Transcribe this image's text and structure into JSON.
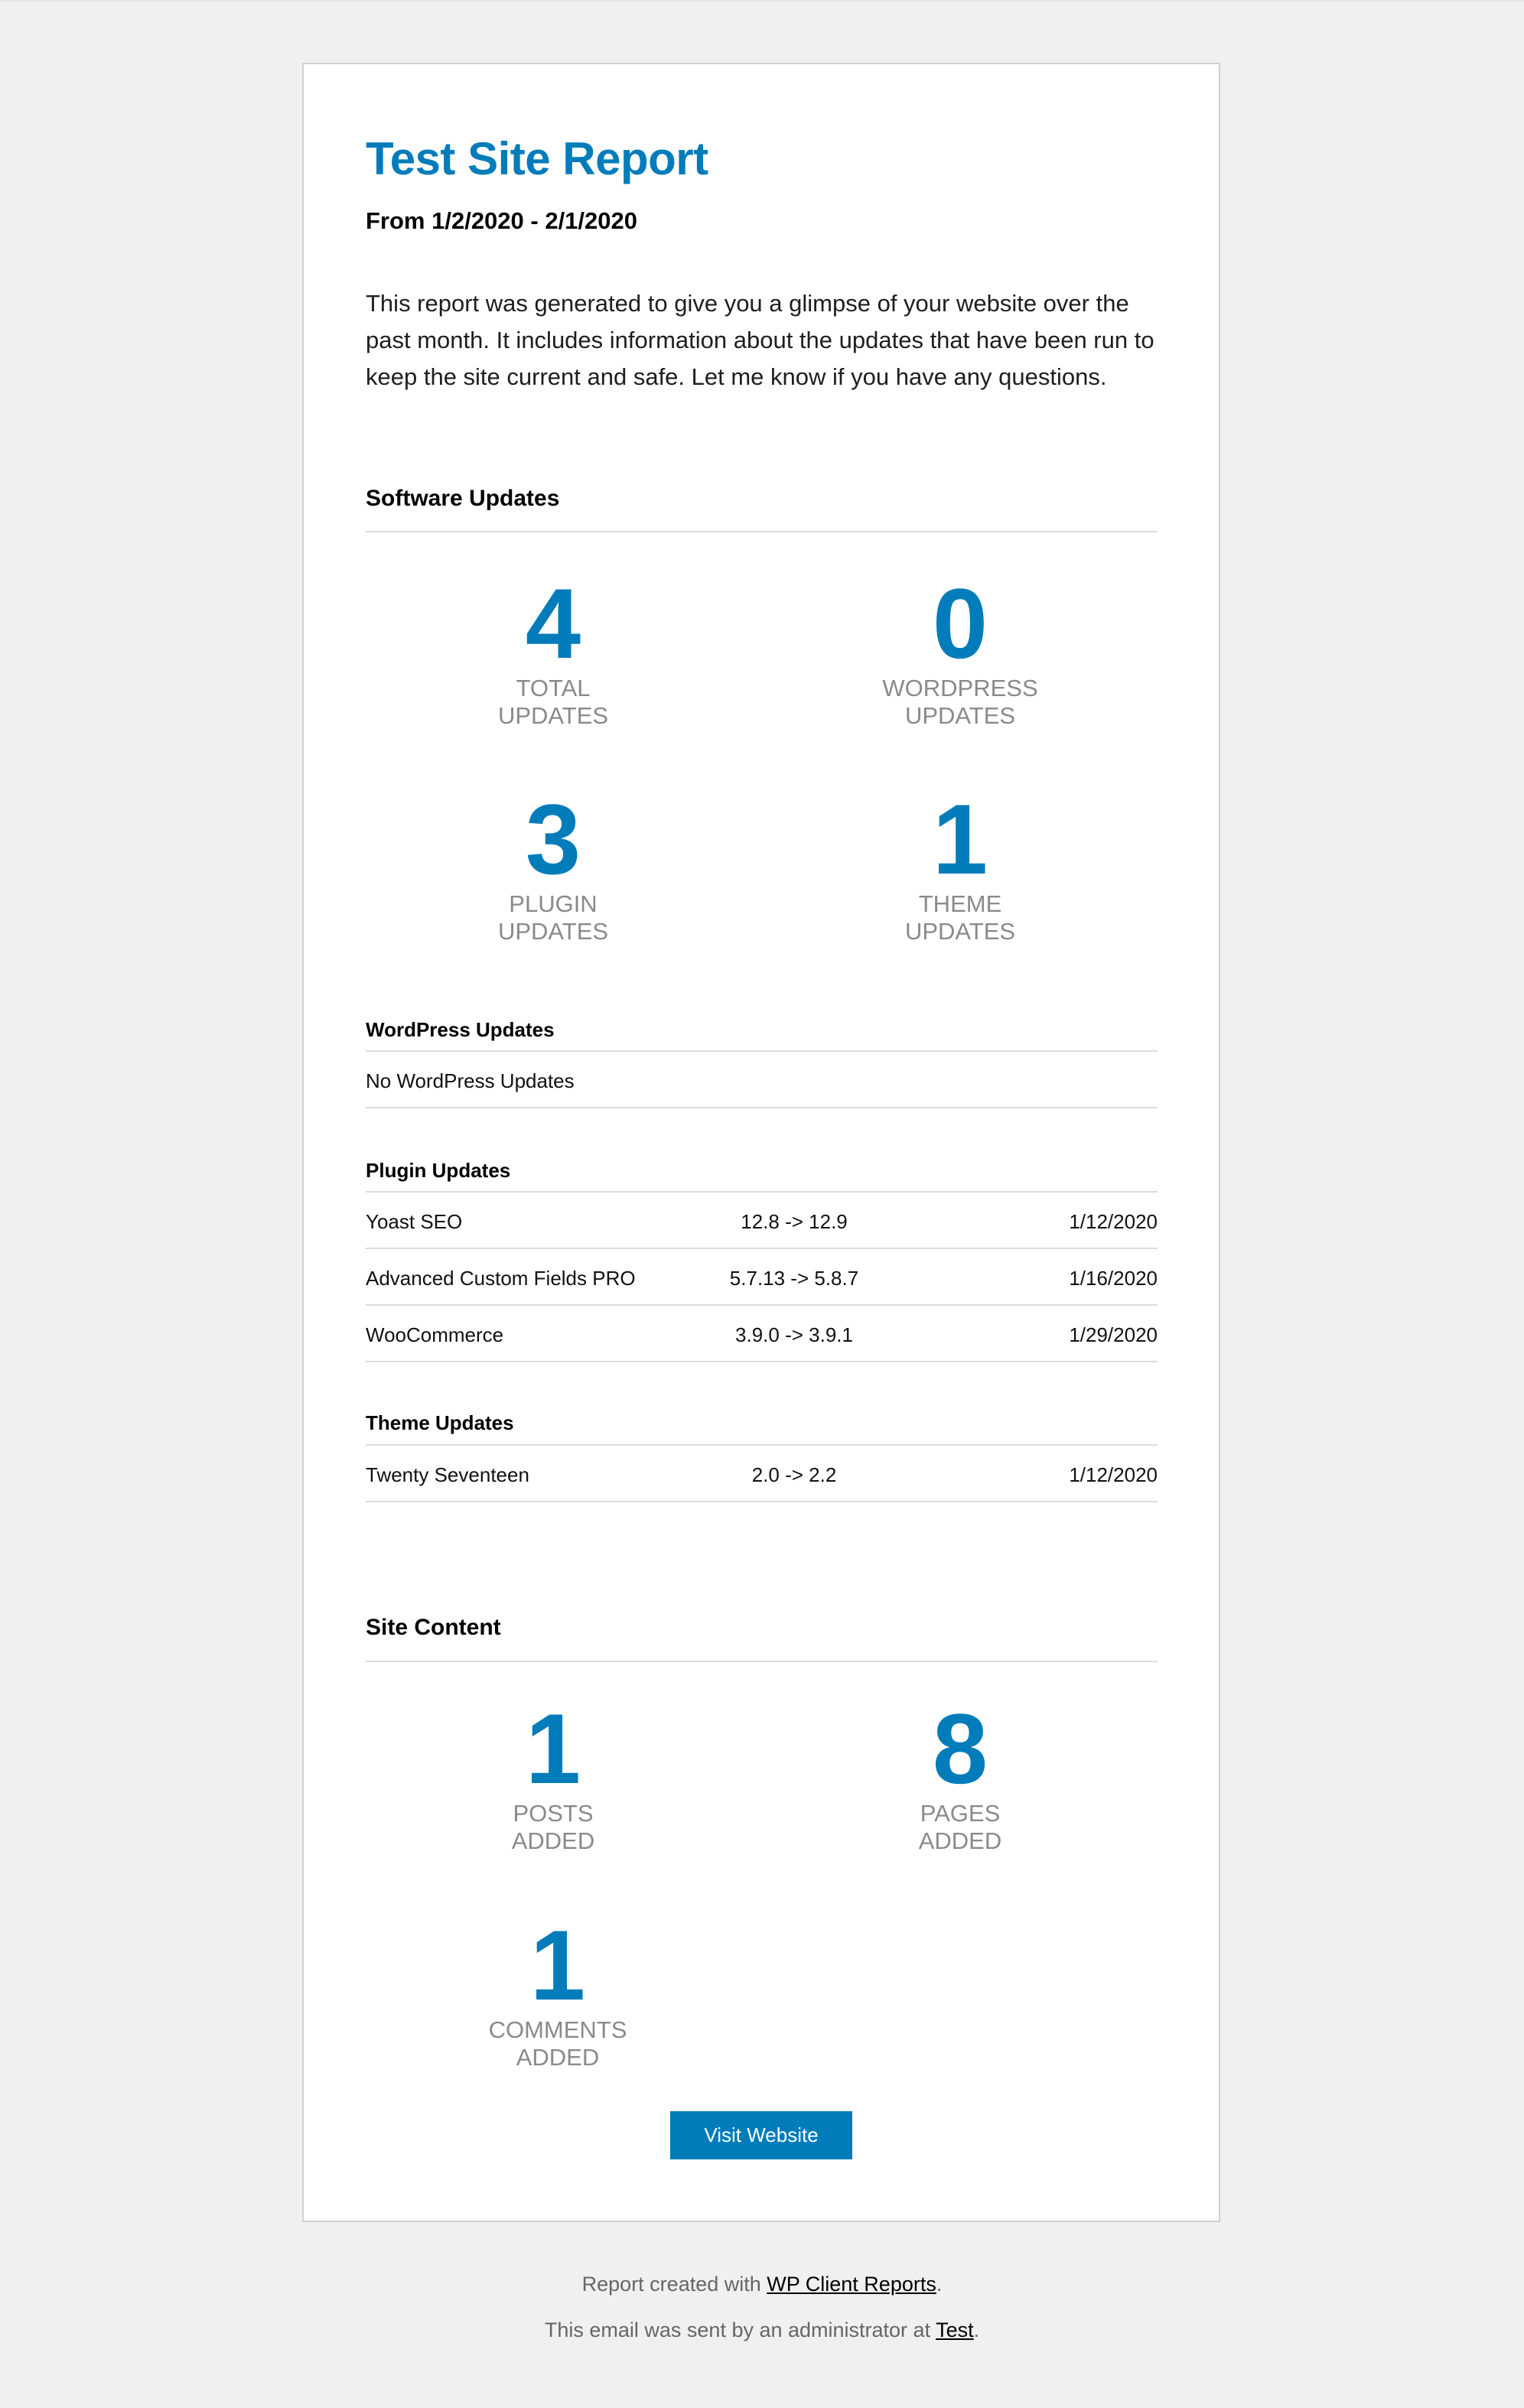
{
  "report": {
    "title": "Test Site Report",
    "date_range": "From 1/2/2020 - 2/1/2020",
    "intro": "This report was generated to give you a glimpse of your website over the past month. It includes information about the updates that have been run to keep the site current and safe. Let me know if you have any questions."
  },
  "software_updates": {
    "heading": "Software Updates",
    "stats": [
      {
        "value": "4",
        "label_line1": "TOTAL",
        "label_line2": "UPDATES"
      },
      {
        "value": "0",
        "label_line1": "WORDPRESS",
        "label_line2": "UPDATES"
      },
      {
        "value": "3",
        "label_line1": "PLUGIN",
        "label_line2": "UPDATES"
      },
      {
        "value": "1",
        "label_line1": "THEME",
        "label_line2": "UPDATES"
      }
    ],
    "wordpress": {
      "heading": "WordPress Updates",
      "empty_text": "No WordPress Updates"
    },
    "plugins": {
      "heading": "Plugin Updates",
      "rows": [
        {
          "name": "Yoast SEO",
          "version": "12.8 -> 12.9",
          "date": "1/12/2020"
        },
        {
          "name": "Advanced Custom Fields PRO",
          "version": "5.7.13 -> 5.8.7",
          "date": "1/16/2020"
        },
        {
          "name": "WooCommerce",
          "version": "3.9.0 -> 3.9.1",
          "date": "1/29/2020"
        }
      ]
    },
    "themes": {
      "heading": "Theme Updates",
      "rows": [
        {
          "name": "Twenty Seventeen",
          "version": "2.0 -> 2.2",
          "date": "1/12/2020"
        }
      ]
    }
  },
  "site_content": {
    "heading": "Site Content",
    "stats": [
      {
        "value": "1",
        "label_line1": "POSTS",
        "label_line2": "ADDED"
      },
      {
        "value": "8",
        "label_line1": "PAGES",
        "label_line2": "ADDED"
      },
      {
        "value": "1",
        "label_line1": "COMMENTS",
        "label_line2": "ADDED"
      }
    ]
  },
  "button": {
    "label": "Visit Website"
  },
  "footer": {
    "line1_prefix": "Report created with ",
    "line1_link": "WP Client Reports",
    "line1_suffix": ".",
    "line2_prefix": "This email was sent by an administrator at ",
    "line2_link": "Test",
    "line2_suffix": "."
  },
  "colors": {
    "accent": "#007cba",
    "label_gray": "#8a8a8a",
    "page_background": "#f0f0f0"
  }
}
